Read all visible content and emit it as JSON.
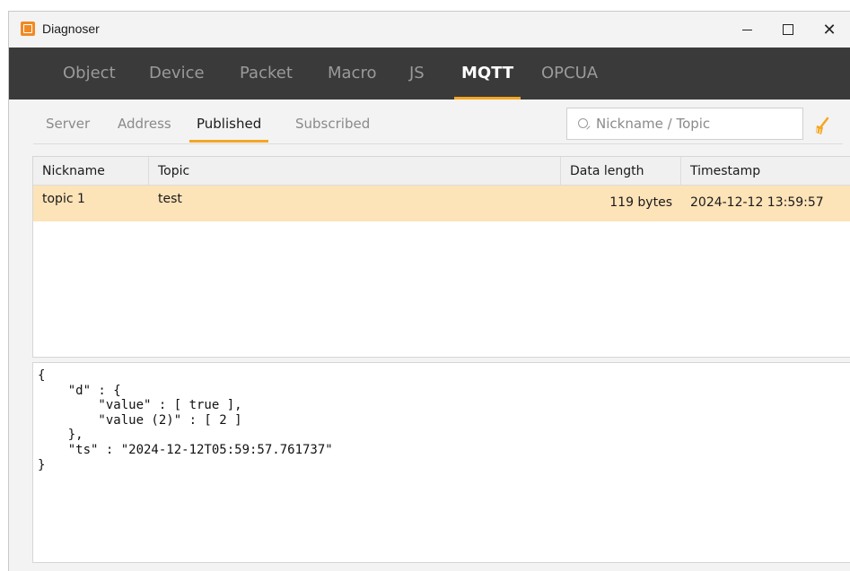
{
  "window": {
    "title": "Diagnoser",
    "controls": {
      "minimize": "—",
      "maximize": "☐",
      "close": "✕"
    }
  },
  "nav": {
    "tabs": [
      {
        "label": "Object"
      },
      {
        "label": "Device"
      },
      {
        "label": "Packet"
      },
      {
        "label": "Macro"
      },
      {
        "label": "JS"
      },
      {
        "label": "MQTT"
      },
      {
        "label": "OPCUA"
      }
    ],
    "active": "MQTT"
  },
  "subnav": {
    "tabs": [
      {
        "label": "Server"
      },
      {
        "label": "Address"
      },
      {
        "label": "Published"
      },
      {
        "label": "Subscribed"
      }
    ],
    "active": "Published"
  },
  "search": {
    "placeholder": "Nickname / Topic",
    "value": ""
  },
  "table": {
    "columns": [
      "Nickname",
      "Topic",
      "Data length",
      "Timestamp"
    ],
    "rows": [
      {
        "nickname": "topic 1",
        "topic": "test",
        "data_length": "119 bytes",
        "timestamp": "2024-12-12 13:59:57"
      }
    ]
  },
  "payload": "{\n    \"d\" : {\n        \"value\" : [ true ],\n        \"value (2)\" : [ 2 ]\n    },\n    \"ts\" : \"2024-12-12T05:59:57.761737\"\n}",
  "colors": {
    "accent": "#f5a623",
    "nav_bg": "#3a3a3a",
    "selected_row": "#fde3b8"
  },
  "icons": {
    "app": "app-logo-icon",
    "search": "search-icon",
    "clear": "broom-clear-icon"
  }
}
